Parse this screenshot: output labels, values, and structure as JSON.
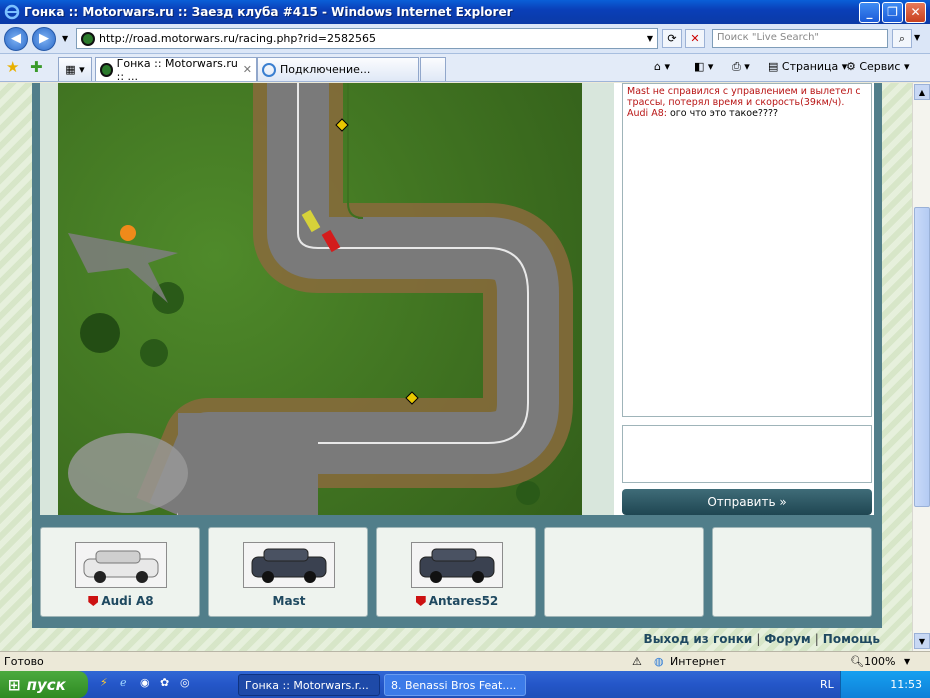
{
  "window": {
    "title": "Гонка :: Motorwars.ru :: Заезд клуба #415 - Windows Internet Explorer"
  },
  "address": {
    "url": "http://road.motorwars.ru/racing.php?rid=2582565",
    "search_placeholder": "Поиск \"Live Search\""
  },
  "tabs": [
    {
      "label": "Гонка :: Motorwars.ru :: ..."
    },
    {
      "label": "Подключение..."
    }
  ],
  "command_bar": {
    "page_label": "Страница",
    "service_label": "Сервис"
  },
  "chat": {
    "system_message": "Mast не справился с управлением и вылетел с трассы, потерял время и скорость(39км/ч).",
    "messages": [
      {
        "nick": "Audi A8:",
        "text": "ого что это такое????"
      }
    ],
    "send_label": "Отправить »"
  },
  "players": [
    {
      "name": "Audi A8",
      "badge": true,
      "car_color": "#e8e8e8"
    },
    {
      "name": "Mast",
      "badge": false,
      "car_color": "#3a4150"
    },
    {
      "name": "Antares52",
      "badge": true,
      "car_color": "#3a4150"
    },
    {
      "name": "",
      "badge": false,
      "car_color": ""
    },
    {
      "name": "",
      "badge": false,
      "car_color": ""
    }
  ],
  "footer_links": [
    "Выход из гонки",
    "Форум",
    "Помощь"
  ],
  "status": {
    "text": "Готово",
    "zone": "Интернет",
    "zoom": "100%"
  },
  "taskbar": {
    "start": "пуск",
    "tasks": [
      "Гонка :: Motorwars.r...",
      "8. Benassi Bros Feat...."
    ],
    "lang": "RL",
    "time": "11:53"
  }
}
